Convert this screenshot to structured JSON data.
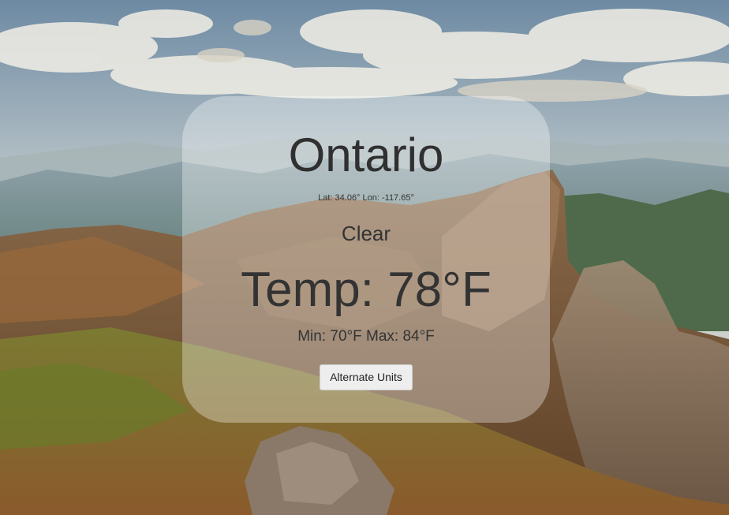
{
  "background": {
    "description_icon": "mountain-landscape-image",
    "sky_color": "#9fb3c4",
    "ground_color": "#7a5a32"
  },
  "weather": {
    "city": "Ontario",
    "coords": "Lat: 34.06° Lon: -117.65°",
    "condition": "Clear",
    "temperature": "Temp: 78°F",
    "min_max": "Min: 70°F Max: 84°F"
  },
  "controls": {
    "alternate_units_label": "Alternate Units"
  }
}
